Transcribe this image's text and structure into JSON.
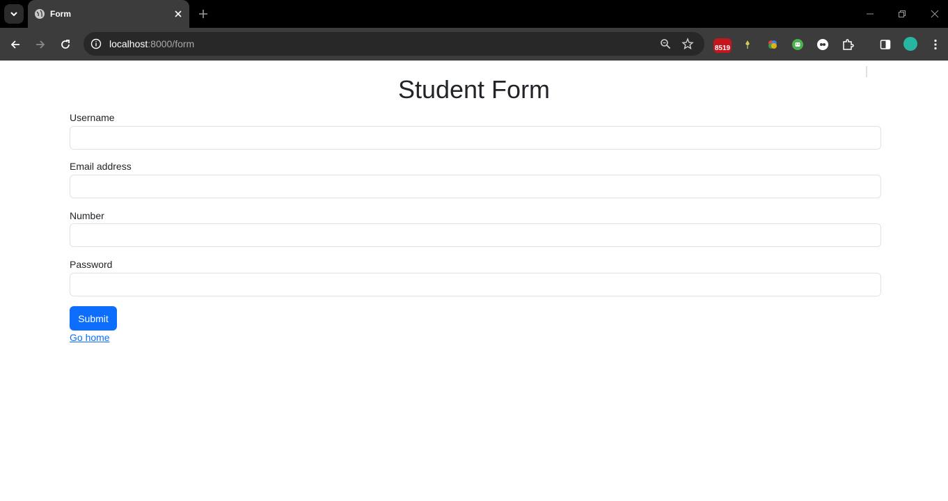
{
  "browser": {
    "tab_title": "Form",
    "url_host": "localhost",
    "url_path": ":8000/form",
    "extension_badge": "8519",
    "colors": {
      "chrome_bg": "#000000",
      "toolbar_bg": "#3c3c3c",
      "omnibox_bg": "#282828",
      "avatar": "#27b6a1"
    }
  },
  "form": {
    "title": "Student Form",
    "fields": [
      {
        "label": "Username",
        "value": "",
        "type": "text"
      },
      {
        "label": "Email address",
        "value": "",
        "type": "email"
      },
      {
        "label": "Number",
        "value": "",
        "type": "text"
      },
      {
        "label": "Password",
        "value": "",
        "type": "password"
      }
    ],
    "submit_label": "Submit",
    "home_link": "Go home",
    "colors": {
      "primary": "#0d6efd",
      "input_border": "#dee2e6",
      "text": "#212529"
    }
  }
}
